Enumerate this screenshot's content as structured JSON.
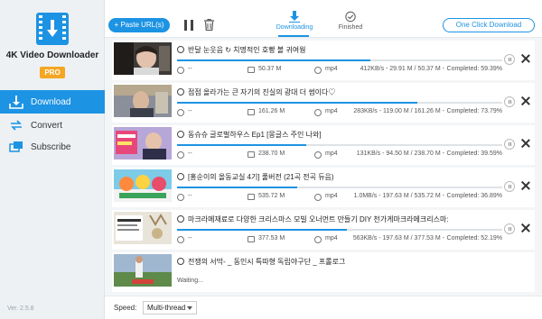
{
  "app": {
    "name": "4K Video Downloader",
    "badge": "PRO",
    "version": "Ver. 2.5.8"
  },
  "sidebar": {
    "items": [
      {
        "label": "Download",
        "icon": "download-tray-icon",
        "active": true
      },
      {
        "label": "Convert",
        "icon": "convert-arrows-icon",
        "active": false
      },
      {
        "label": "Subscribe",
        "icon": "subscribe-icon",
        "active": false
      }
    ]
  },
  "toolbar": {
    "paste_label": "+ Paste URL(s)",
    "tabs": [
      {
        "label": "Downloading",
        "icon": "download-arrow-icon",
        "active": true
      },
      {
        "label": "Finished",
        "icon": "check-circle-icon",
        "active": false
      }
    ],
    "one_click_label": "One Click Download"
  },
  "downloads": [
    {
      "title": "반달 눈웃음 ↻ 치명적인 호빵 볼 귀여웜",
      "duration": "--",
      "size": "50.37 M",
      "format": "mp4",
      "rate": "412KB/s - 29.91 M / 50.37 M -",
      "completed": "Completed: 59.39%",
      "progress": 0.5939
    },
    {
      "title": "점점 올라가는 큰 자기의 진실의 광대 더 썸이다♡",
      "duration": "--",
      "size": "161.26 M",
      "format": "mp4",
      "rate": "283KB/s - 119.00 M / 161.26 M -",
      "completed": "Completed: 73.79%",
      "progress": 0.7379
    },
    {
      "title": "동슈슈 글로벌하우스 Ep1 [몽글스 주인 나와]",
      "duration": "--",
      "size": "238.70 M",
      "format": "mp4",
      "rate": "131KB/s - 94.50 M / 238.70 M -",
      "completed": "Completed: 39.59%",
      "progress": 0.3959
    },
    {
      "title": "[홍순이의 올동교실 4기] 풀버전 (21곡 전곡 듀음)",
      "duration": "--",
      "size": "535.72 M",
      "format": "mp4",
      "rate": "1.0MB/s - 197.63 M / 535.72 M -",
      "completed": "Completed: 36.89%",
      "progress": 0.3689
    },
    {
      "title": "마크라메재료로 다양한 크리스마스 모빌 오너먼트 만들기 DIY 천가게마크라메크리스마:",
      "duration": "--",
      "size": "377.53 M",
      "format": "mp4",
      "rate": "563KB/s - 197.63 M / 377.53 M -",
      "completed": "Completed: 52.19%",
      "progress": 0.5219
    },
    {
      "title": "전쟁의 서막- _ 동인시 특따형 독립야구단 _ 프롤로그",
      "duration": "",
      "size": "",
      "format": "",
      "rate": "",
      "completed": "",
      "status": "Waiting...",
      "progress": 0
    }
  ],
  "bottom": {
    "speed_label": "Speed:",
    "speed_value": "Multi-thread"
  },
  "colors": {
    "accent": "#1d93e3",
    "sidebar_bg": "#eef1f4",
    "list_bg": "#f3f5f7"
  }
}
